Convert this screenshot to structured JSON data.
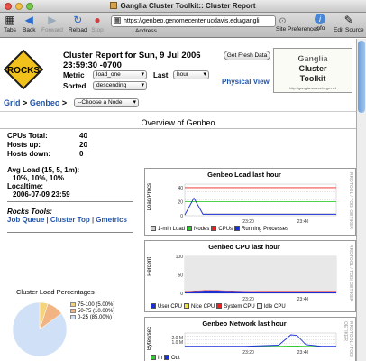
{
  "window": {
    "title": "Ganglia Cluster Toolkit:: Cluster Report"
  },
  "toolbar": {
    "tabs": "Tabs",
    "back": "Back",
    "forward": "Forward",
    "reload": "Reload",
    "stop": "Stop",
    "address_label": "Address",
    "url": "https://genbeo.genomecenter.ucdavis.edu/gangli",
    "site_prefs": "Site Preferences",
    "info": "Info",
    "edit_source": "Edit Source"
  },
  "header": {
    "logo_text": "ROCKS",
    "title_line1": "Cluster Report for Sun, 9 Jul 2006",
    "title_line2": "23:59:30 -0700",
    "fresh_button": "Get Fresh Data",
    "metric_label": "Metric",
    "metric_value": "load_one",
    "last_label": "Last",
    "last_value": "hour",
    "sorted_label": "Sorted",
    "sorted_value": "descending",
    "physical_view": "Physical View",
    "toolkit_logo": "Ganglia Cluster Toolkit",
    "toolkit_url": "http://ganglia.sourceforge.net"
  },
  "nav": {
    "grid": "Grid",
    "sep": ">",
    "cluster": "Genbeo",
    "sep2": ">",
    "node_select": "--Choose a Node"
  },
  "overview": {
    "title": "Overview of Genbeo"
  },
  "stats": [
    {
      "label": "CPUs Total:",
      "value": "40"
    },
    {
      "label": "Hosts up:",
      "value": "20"
    },
    {
      "label": "Hosts down:",
      "value": "0"
    }
  ],
  "avg_load": {
    "label": "Avg Load (15, 5, 1m):",
    "value": "10%, 10%, 10%"
  },
  "localtime": {
    "label": "Localtime:",
    "value": "2006-07-09 23:59"
  },
  "tools": {
    "title": "Rocks Tools:",
    "job_queue": "Job Queue",
    "cluster_top": "Cluster Top",
    "gmetrics": "Gmetrics",
    "sep": "|"
  },
  "pie": {
    "title": "Cluster Load Percentages",
    "slices": [
      {
        "label": "75-100 (5.00%)",
        "value": 5,
        "color": "#f4d37a"
      },
      {
        "label": "50-75 (10.00%)",
        "value": 10,
        "color": "#f2b482"
      },
      {
        "label": "0-25 (85.00%)",
        "value": 85,
        "color": "#cfe0f7"
      }
    ]
  },
  "graphs": {
    "load": {
      "title": "Genbeo Load last hour",
      "ylabel": "Load/Procs",
      "side": "RRDTOOL / TOBI OETIKER",
      "yticks": [
        "40",
        "20",
        "0"
      ],
      "xticks": [
        "23:20",
        "23:40"
      ],
      "legend": [
        "1-min Load",
        "Nodes",
        "CPUs",
        "Running Processes"
      ],
      "colors": [
        "#cccccc",
        "#33cc33",
        "#ee2222",
        "#1a2fd8"
      ],
      "chart_data": {
        "type": "line",
        "x": [
          "23:00",
          "23:10",
          "23:20",
          "23:30",
          "23:40",
          "23:50",
          "23:59"
        ],
        "series": [
          {
            "name": "1-min Load",
            "values": [
              2,
              25,
              3,
              3,
              3,
              3,
              3
            ]
          },
          {
            "name": "Nodes",
            "values": [
              20,
              20,
              20,
              20,
              20,
              20,
              20
            ]
          },
          {
            "name": "CPUs",
            "values": [
              40,
              40,
              40,
              40,
              40,
              40,
              40
            ]
          },
          {
            "name": "Running Processes",
            "values": [
              1,
              25,
              2,
              2,
              2,
              2,
              2
            ]
          }
        ],
        "ylim": [
          0,
          45
        ]
      }
    },
    "cpu": {
      "title": "Genbeo CPU last hour",
      "ylabel": "Percent",
      "side": "RRDTOOL / TOBI OETIKER",
      "yticks": [
        "100",
        "50",
        "0"
      ],
      "xticks": [
        "23:20",
        "23:40"
      ],
      "legend": [
        "User CPU",
        "Nice CPU",
        "System CPU",
        "Idle CPU"
      ],
      "colors": [
        "#1a2fd8",
        "#f2e24a",
        "#ee2222",
        "#e8e8e8"
      ],
      "chart_data": {
        "type": "area",
        "x": [
          "23:00",
          "23:10",
          "23:20",
          "23:30",
          "23:40",
          "23:50",
          "23:59"
        ],
        "series": [
          {
            "name": "User CPU",
            "values": [
              5,
              8,
              6,
              5,
              5,
              5,
              5
            ]
          },
          {
            "name": "Nice CPU",
            "values": [
              0,
              0,
              0,
              0,
              0,
              0,
              0
            ]
          },
          {
            "name": "System CPU",
            "values": [
              1,
              1,
              1,
              1,
              1,
              1,
              1
            ]
          },
          {
            "name": "Idle CPU",
            "values": [
              94,
              91,
              93,
              94,
              94,
              94,
              94
            ]
          }
        ],
        "ylim": [
          0,
          100
        ]
      }
    },
    "network": {
      "title": "Genbeo Network last hour",
      "ylabel": "Bytes/sec",
      "side": "RRDTOOL / TOBI OETIKER",
      "yticks": [
        "2.0 M",
        "1.0 M"
      ],
      "xticks": [
        "23:20",
        "23:40"
      ],
      "legend": [
        "In",
        "Out"
      ],
      "colors": [
        "#33cc33",
        "#1a2fd8"
      ],
      "chart_data": {
        "type": "line",
        "x": [
          "23:00",
          "23:10",
          "23:20",
          "23:30",
          "23:35",
          "23:38",
          "23:42",
          "23:50",
          "23:59"
        ],
        "series": [
          {
            "name": "In",
            "values": [
              0.02,
              0.02,
              0.02,
              0.05,
              0.1,
              0.1,
              0.05,
              0.02,
              0.02
            ]
          },
          {
            "name": "Out",
            "values": [
              0.05,
              0.05,
              0.05,
              0.3,
              2.6,
              2.5,
              0.4,
              0.05,
              0.05
            ]
          }
        ],
        "ylim": [
          0,
          3
        ]
      }
    }
  }
}
